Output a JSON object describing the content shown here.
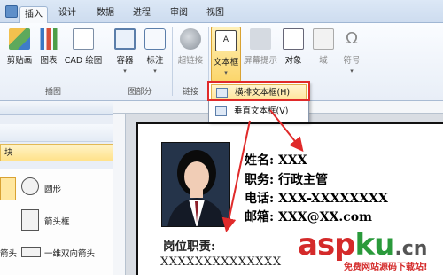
{
  "tabs": [
    "插入",
    "设计",
    "数据",
    "进程",
    "审阅",
    "视图"
  ],
  "ribbon": {
    "commands": {
      "cut_image": "剪贴画",
      "chart": "图表",
      "cad": "CAD 绘图",
      "container": "容器",
      "callout": "标注",
      "hyperlink": "超链接",
      "textbox": "文本框",
      "screentip": "屏幕提示",
      "object": "对象",
      "field": "域",
      "symbol": "符号"
    },
    "groups": {
      "illustrations": "插图",
      "diagram_parts": "图部分",
      "links": "链接"
    }
  },
  "dropdown": {
    "horizontal": "横排文本框(H)",
    "vertical": "垂直文本框(V)"
  },
  "left_panel": {
    "row1": "",
    "row2": "块",
    "shapes": {
      "circle": "圆形",
      "arrow_box": "箭头框",
      "arrow_short": "箭头",
      "dbl_arrow": "一维双向箭头"
    }
  },
  "resume": {
    "name_line": "姓名: XXX",
    "title_line": "职务: 行政主管",
    "phone_line": "电话: XXX-XXXXXXXX",
    "email_line": "邮箱: XXX@XX.com",
    "job_heading": "岗位职责:",
    "job_text": "XXXXXXXXXXXXXX"
  },
  "watermark": {
    "brand_asp": "asp",
    "brand_ku": "ku",
    "brand_cn": ".cn",
    "sub": "免费网站源码下载站!"
  },
  "colors": {
    "accent_red": "#e02a2a",
    "ribbon_blue": "#cddcef",
    "watermark_gray": "#555555"
  }
}
